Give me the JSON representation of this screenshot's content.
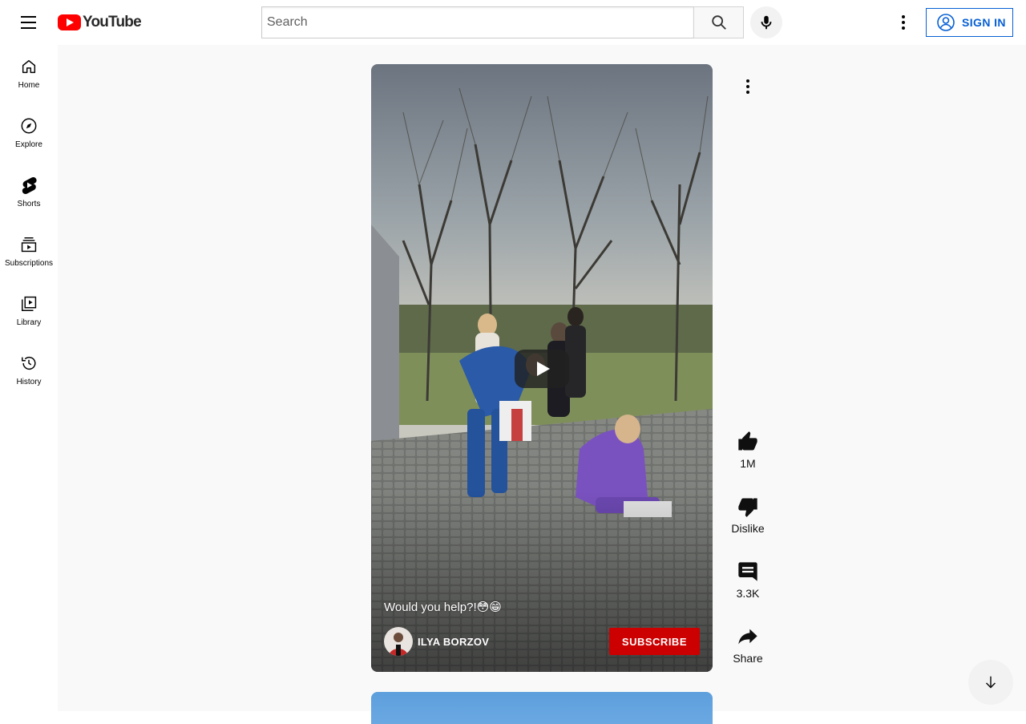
{
  "header": {
    "logo_text": "YouTube",
    "search_placeholder": "Search",
    "signin_label": "SIGN IN"
  },
  "sidebar": {
    "items": [
      {
        "label": "Home",
        "icon": "home-icon"
      },
      {
        "label": "Explore",
        "icon": "compass-icon"
      },
      {
        "label": "Shorts",
        "icon": "shorts-icon"
      },
      {
        "label": "Subscriptions",
        "icon": "subscriptions-icon"
      },
      {
        "label": "Library",
        "icon": "library-icon"
      },
      {
        "label": "History",
        "icon": "history-icon"
      }
    ]
  },
  "short": {
    "title": "Would you help?!😳😁",
    "channel": "ILYA BORZOV",
    "subscribe_label": "SUBSCRIBE"
  },
  "actions": {
    "likes": "1M",
    "dislike_label": "Dislike",
    "comments": "3.3K",
    "share_label": "Share"
  },
  "colors": {
    "brand_red": "#ff0000",
    "subscribe_red": "#cc0000",
    "signin_blue": "#065fd4"
  }
}
